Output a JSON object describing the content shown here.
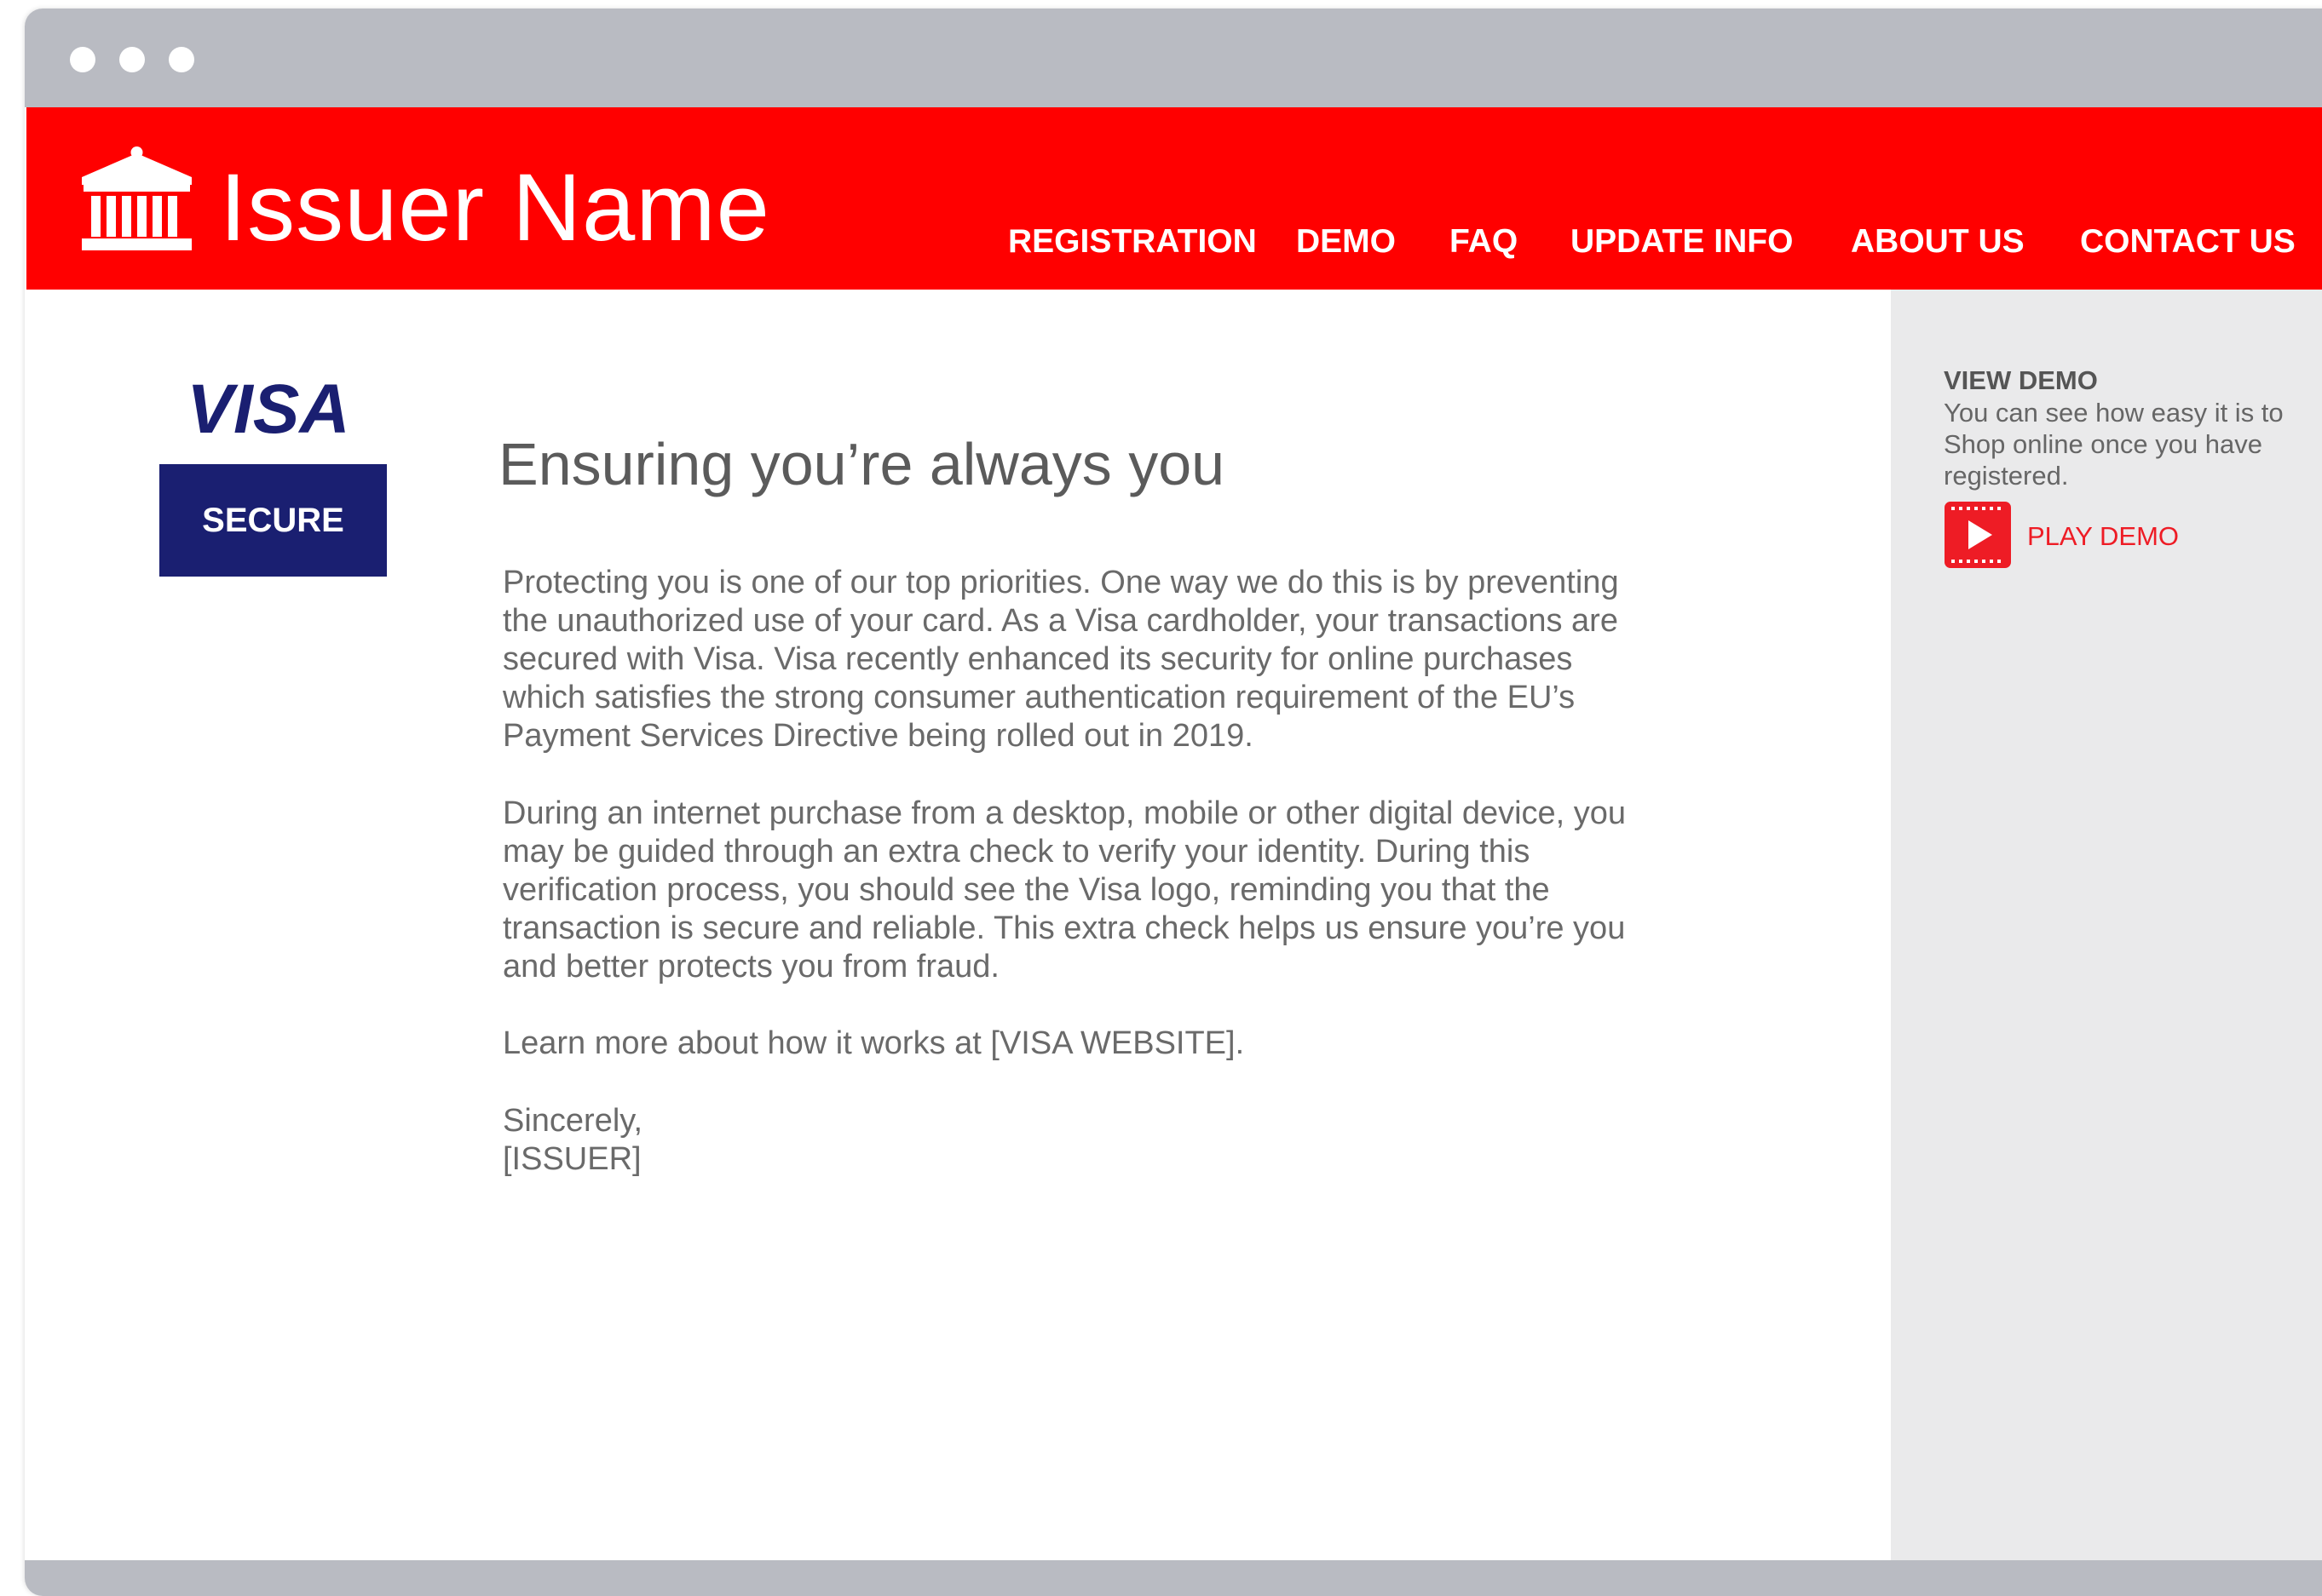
{
  "window": {
    "controls": [
      "window-dot",
      "window-dot",
      "window-dot"
    ]
  },
  "header": {
    "brand_name": "Issuer Name",
    "logo_icon": "bank-building-icon",
    "background_color": "#ff0000",
    "nav": [
      "REGISTRATION",
      "DEMO",
      "FAQ",
      "UPDATE INFO",
      "ABOUT US",
      "CONTACT US"
    ]
  },
  "badge": {
    "visa_text": "VISA",
    "secure_text": "SECURE",
    "badge_color": "#1a1f71"
  },
  "main": {
    "title": "Ensuring you’re always you",
    "paragraphs": [
      "Protecting you is one of our top priorities. One way we do this is by preventing\nthe unauthorized use of your card.  As a Visa cardholder, your transactions are\nsecured with Visa.  Visa recently enhanced its security for online purchases\nwhich satisfies the strong consumer authentication requirement of the EU’s\nPayment Services Directive being rolled out in 2019.",
      "During an internet purchase from a desktop, mobile or other digital device, you\nmay be guided through an extra check to verify your identity.  During this\nverification process, you should see the Visa logo, reminding you that the\ntransaction is secure and reliable.  This extra check helps us ensure you’re you\nand better protects you from fraud.",
      "Learn more about how it works at [VISA WEBSITE].",
      "Sincerely,\n[ISSUER]"
    ]
  },
  "sidebar": {
    "heading": "VIEW DEMO",
    "description": "You can see how easy it is to\nShop online once you have\nregistered.",
    "play_icon": "play-video-icon",
    "play_label": "PLAY DEMO",
    "accent_color": "#ee1c25"
  }
}
